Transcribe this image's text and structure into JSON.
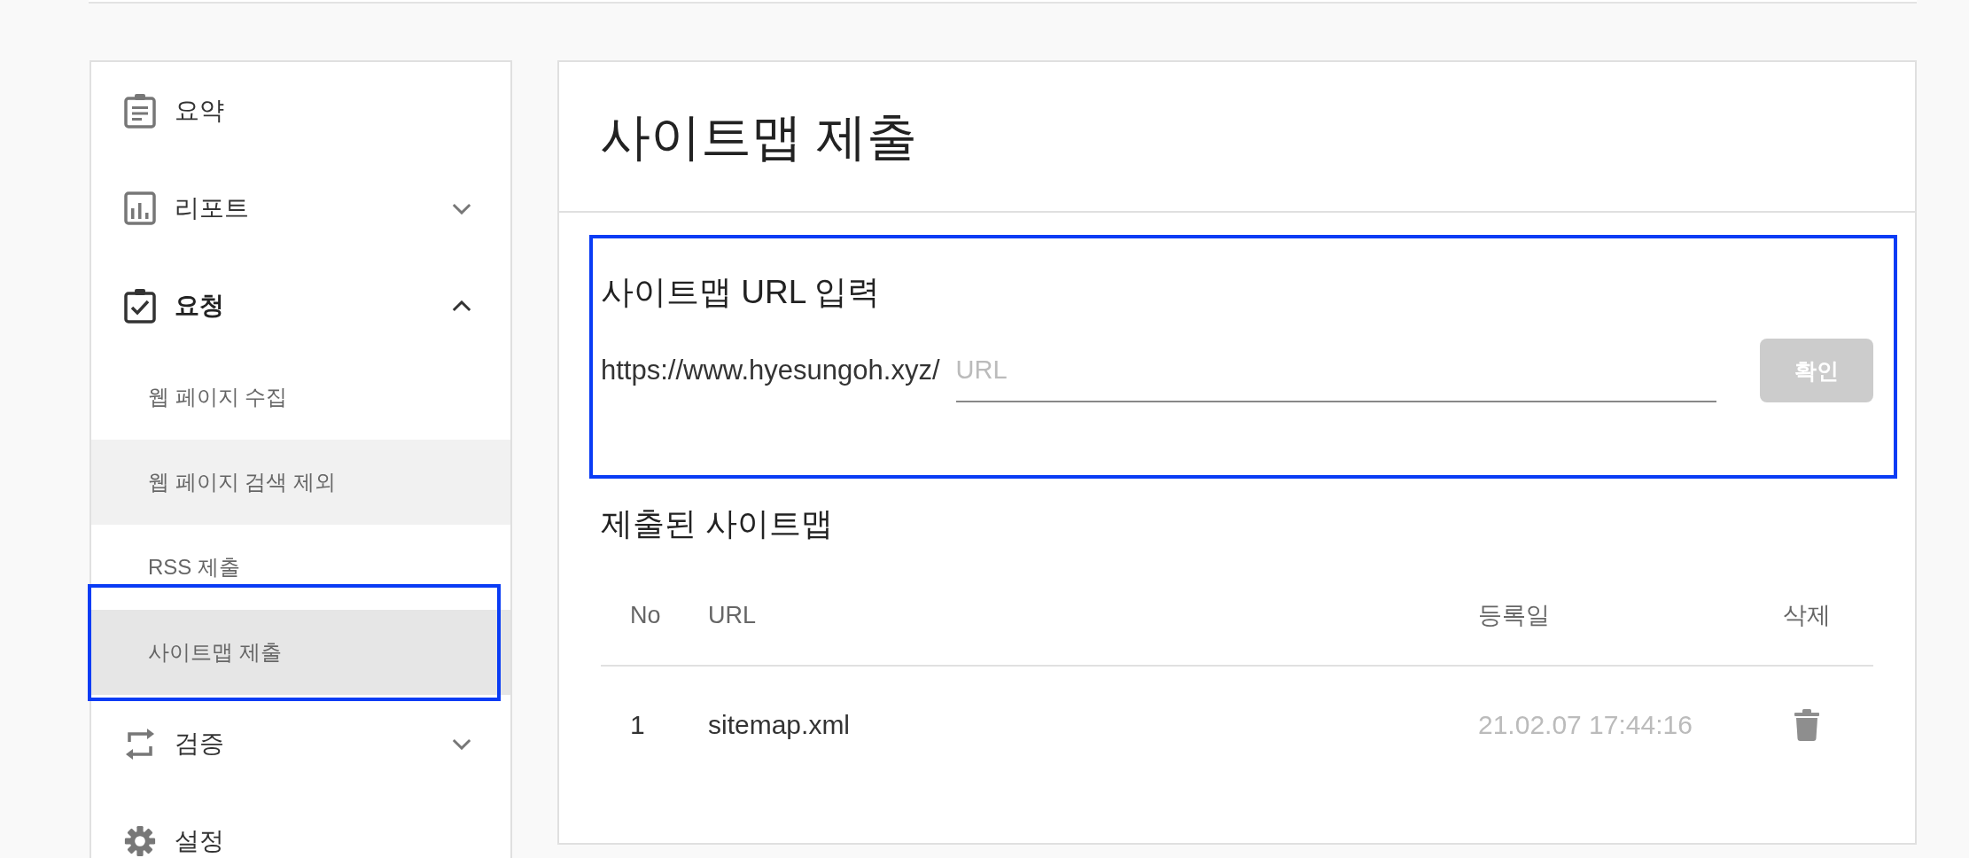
{
  "sidebar": {
    "items": [
      {
        "kind": "link",
        "label": "요약"
      },
      {
        "kind": "group",
        "label": "리포트",
        "expanded": false
      },
      {
        "kind": "group",
        "label": "요청",
        "expanded": true,
        "children": [
          {
            "label": "웹 페이지 수집",
            "selected": false,
            "hovered": false,
            "highlighted": false
          },
          {
            "label": "웹 페이지 검색 제외",
            "selected": false,
            "hovered": true,
            "highlighted": false
          },
          {
            "label": "RSS 제출",
            "selected": false,
            "hovered": false,
            "highlighted": false
          },
          {
            "label": "사이트맵 제출",
            "selected": true,
            "hovered": false,
            "highlighted": true
          }
        ]
      },
      {
        "kind": "group",
        "label": "검증",
        "expanded": false
      },
      {
        "kind": "link",
        "label": "설정"
      }
    ]
  },
  "page_title": "사이트맵 제출",
  "submit_form": {
    "highlighted": true,
    "heading": "사이트맵 URL 입력",
    "url_prefix": "https://www.hyesungoh.xyz/",
    "url_field": {
      "placeholder": "URL"
    },
    "confirm_button": {
      "label": "확인",
      "disabled": true
    }
  },
  "submitted_sitemaps": {
    "heading": "제출된 사이트맵",
    "table": {
      "columns": [
        "No",
        "URL",
        "등록일",
        "삭제"
      ],
      "rows": [
        {
          "cells": [
            "1",
            "sitemap.xml",
            "21.02.07 17:44:16"
          ]
        }
      ]
    }
  }
}
